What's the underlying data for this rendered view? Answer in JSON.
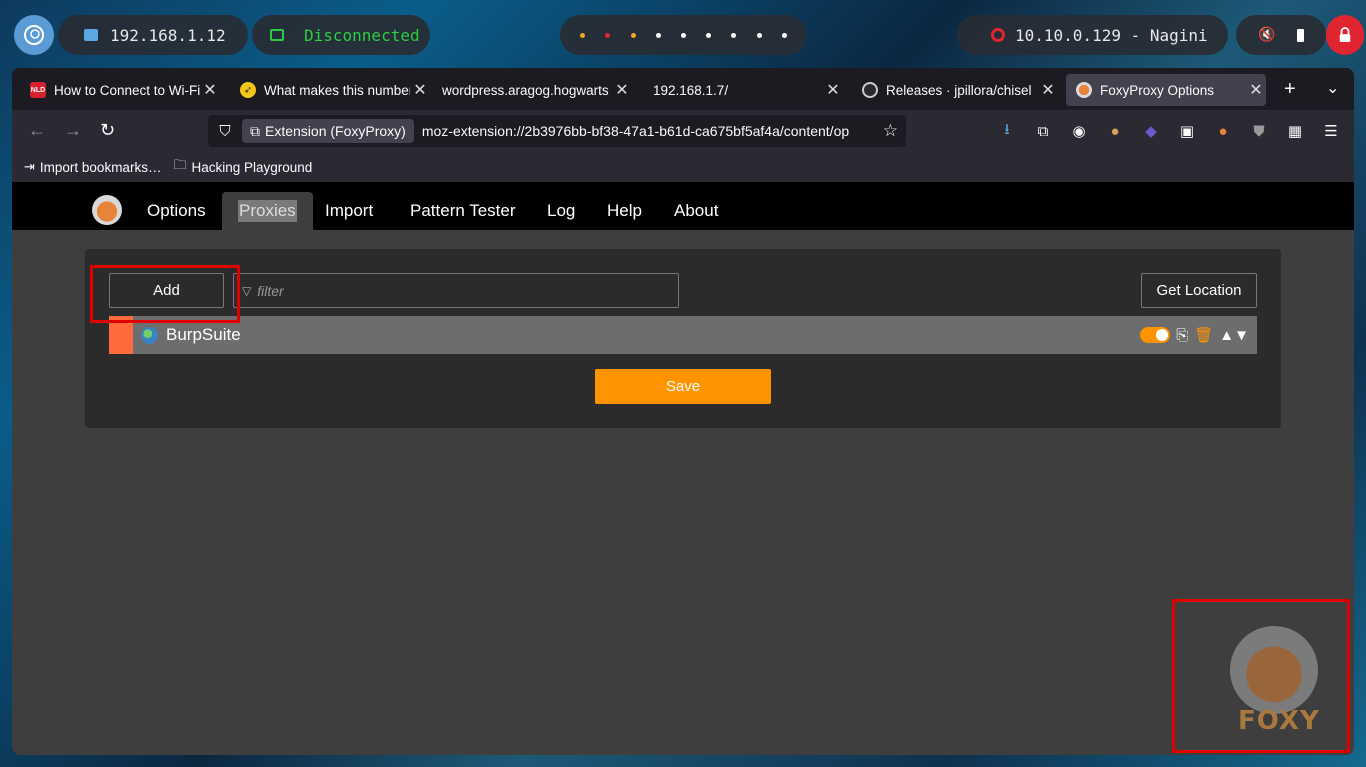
{
  "desktop": {
    "local_ip": "192.168.1.12",
    "vpn_status": "Disconnected",
    "target": "10.10.0.129 - Nagini"
  },
  "browser": {
    "tabs": [
      {
        "title": "How to Connect to Wi-Fi",
        "favicon": "red-logo-icon"
      },
      {
        "title": "What makes this number",
        "favicon": "rocket-icon"
      },
      {
        "title": "wordpress.aragog.hogwarts",
        "favicon": ""
      },
      {
        "title": "192.168.1.7/",
        "favicon": ""
      },
      {
        "title": "Releases · jpillora/chisel",
        "favicon": "github-icon"
      },
      {
        "title": "FoxyProxy Options",
        "favicon": "foxyproxy-icon"
      }
    ],
    "url_chip": "Extension (FoxyProxy)",
    "url": "moz-extension://2b3976bb-bf38-47a1-b61d-ca675bf5af4a/content/op",
    "bookmarks": [
      {
        "label": "Import bookmarks…",
        "icon": "import-icon"
      },
      {
        "label": "Hacking Playground",
        "icon": "folder-icon"
      }
    ]
  },
  "foxy": {
    "nav": [
      "Options",
      "Proxies",
      "Import",
      "Pattern Tester",
      "Log",
      "Help",
      "About"
    ],
    "active_tab": "Proxies",
    "add_label": "Add",
    "filter_placeholder": "filter",
    "get_location_label": "Get Location",
    "proxy": {
      "title": "BurpSuite",
      "color": "#ff6a3d",
      "enabled": true
    },
    "save_label": "Save",
    "watermark": "FOXY"
  },
  "colors": {
    "accent": "#ff9400",
    "highlight": "#e00000"
  }
}
